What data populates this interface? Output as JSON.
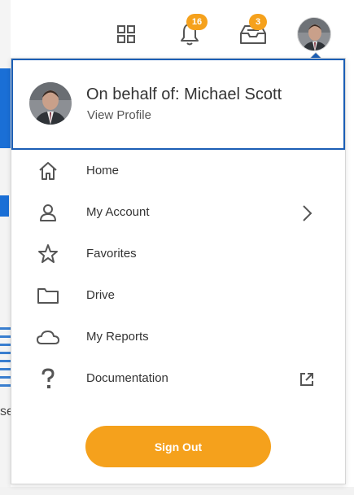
{
  "header": {
    "apps_icon": "grid-icon",
    "notifications": {
      "icon": "bell-icon",
      "count": "16"
    },
    "inbox": {
      "icon": "inbox-icon",
      "count": "3"
    },
    "avatar_icon": "user-avatar"
  },
  "profile": {
    "name": "On behalf of: Michael Scott",
    "link": "View Profile"
  },
  "menu": {
    "items": [
      {
        "label": "Home",
        "icon": "home-icon"
      },
      {
        "label": "My Account",
        "icon": "user-icon",
        "trailing": "chevron-right-icon"
      },
      {
        "label": "Favorites",
        "icon": "star-icon"
      },
      {
        "label": "Drive",
        "icon": "folder-icon"
      },
      {
        "label": "My Reports",
        "icon": "cloud-icon"
      },
      {
        "label": "Documentation",
        "icon": "question-icon",
        "trailing": "external-link-icon"
      }
    ]
  },
  "signout": {
    "label": "Sign Out"
  },
  "background": {
    "fragment_text": "se"
  },
  "colors": {
    "accent": "#f5a11c",
    "focus_border": "#1b5eb5",
    "icon": "#555555"
  }
}
